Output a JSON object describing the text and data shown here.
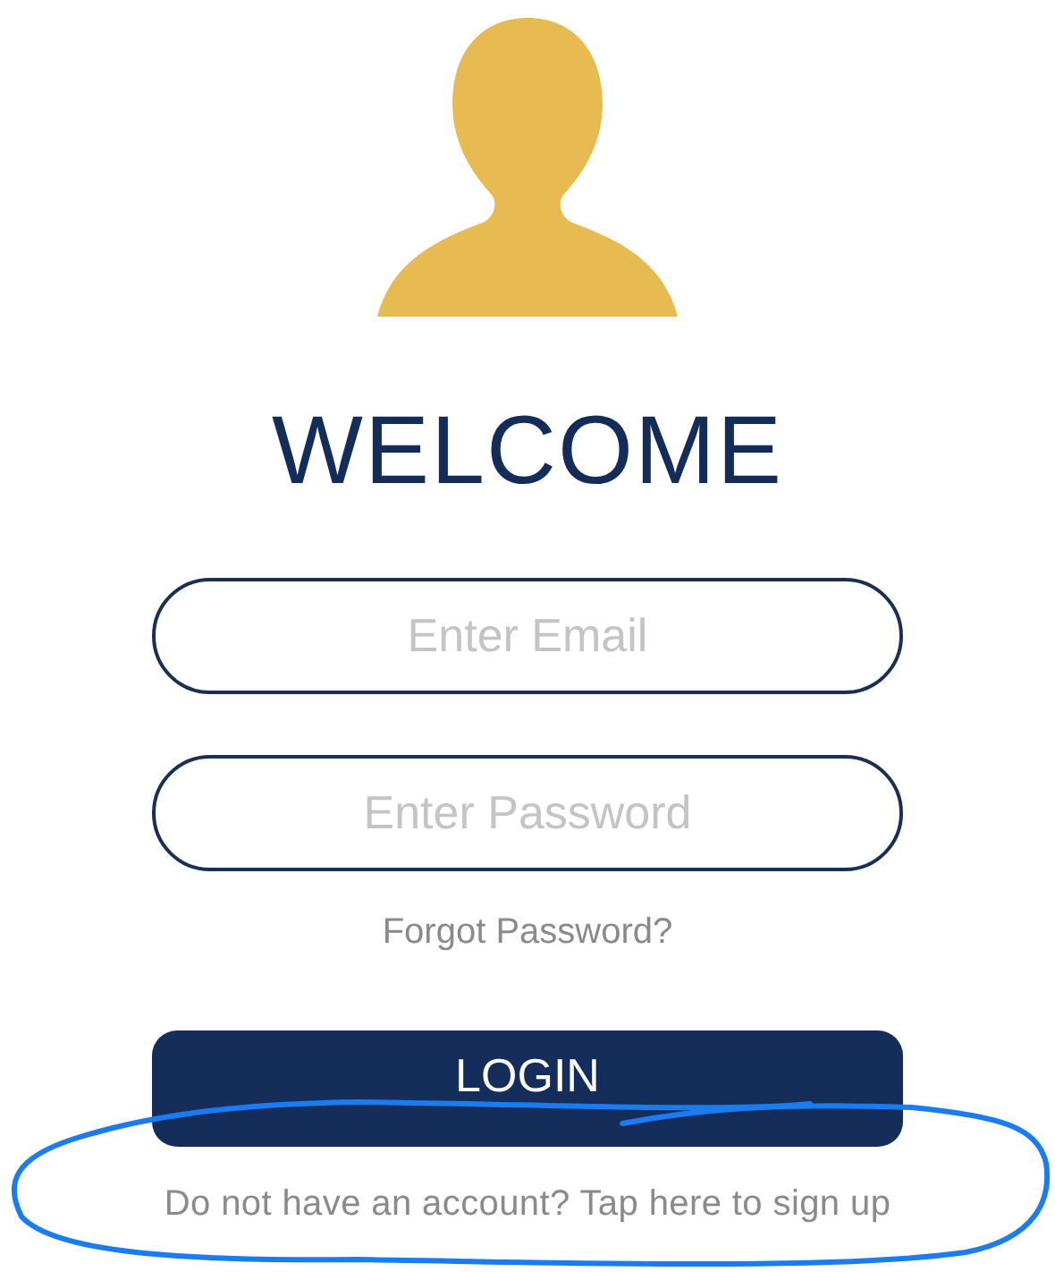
{
  "title": "WELCOME",
  "email_field": {
    "placeholder": "Enter Email"
  },
  "password_field": {
    "placeholder": "Enter Password"
  },
  "forgot_link": "Forgot Password?",
  "login_button": "LOGIN",
  "signup_text": "Do not have an account? Tap here to sign up"
}
